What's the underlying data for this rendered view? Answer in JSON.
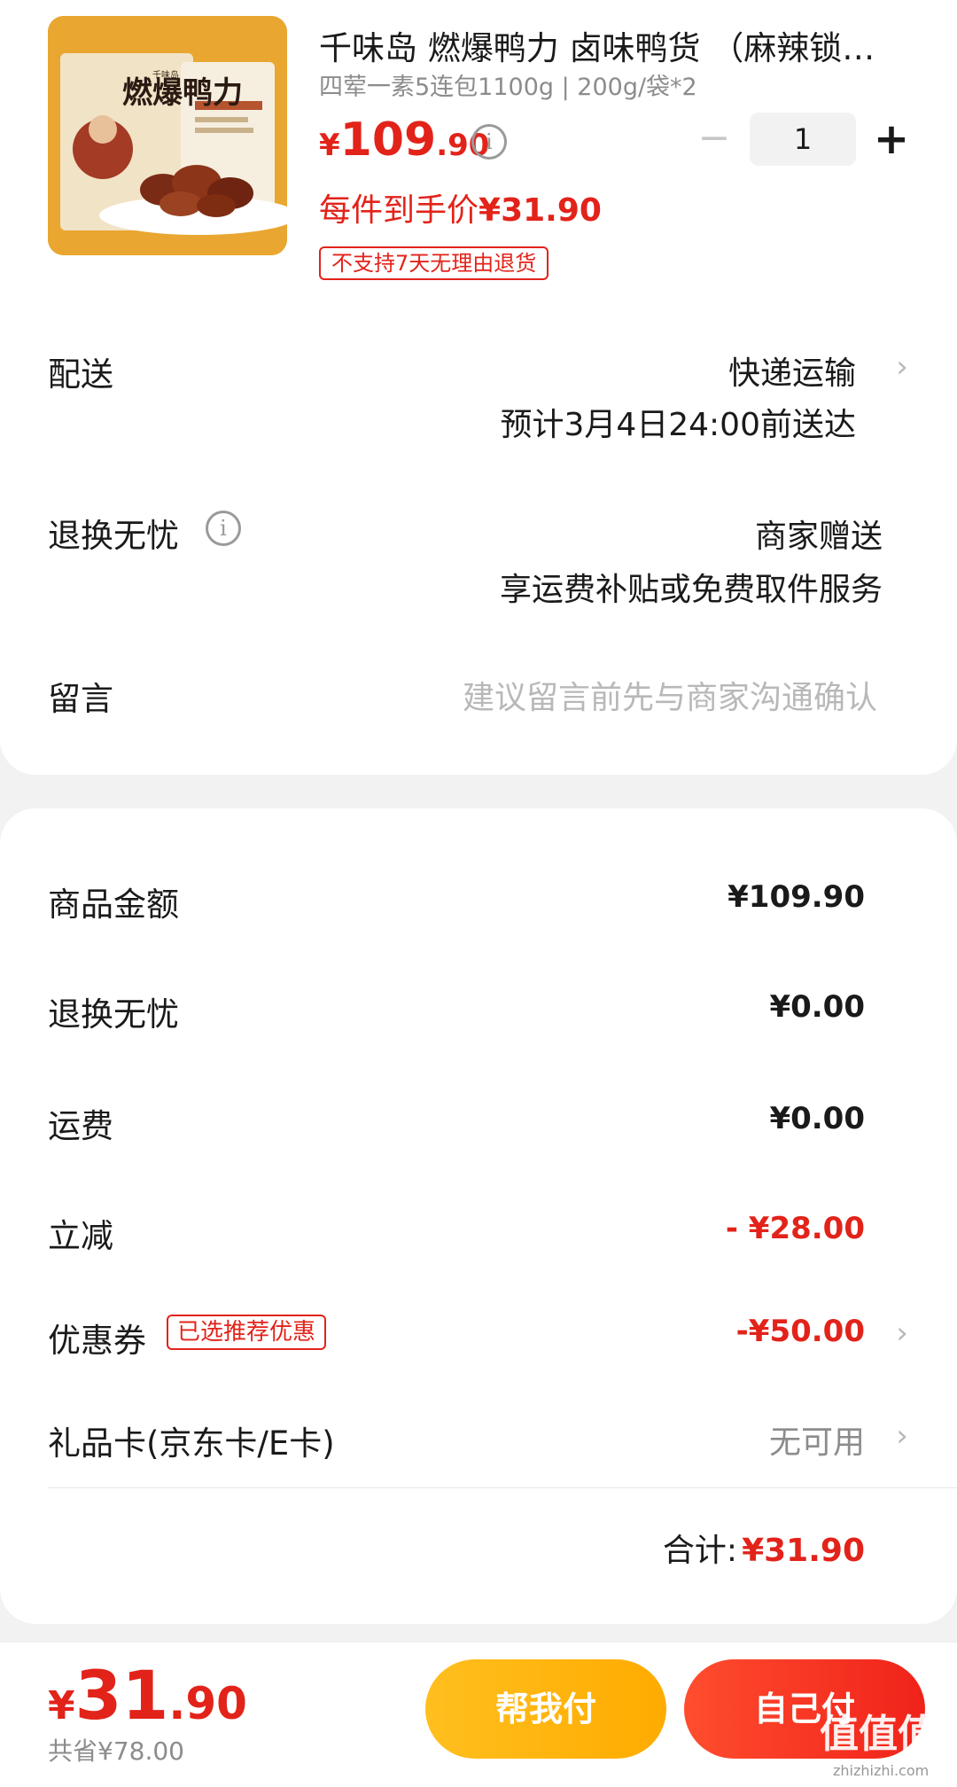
{
  "product": {
    "title": "千味岛 燃爆鸭力 卤味鸭货 （麻辣锁…",
    "spec": "四荤一素5连包1100g | 200g/袋*2",
    "price_currency": "¥",
    "price_int": "109",
    "price_dec": ".90",
    "quantity": "1",
    "minus_label": "−",
    "plus_label": "+",
    "unit_price_label": "每件到手价",
    "unit_price_value": "¥31.90",
    "return_badge": "不支持7天无理由退货",
    "image_text": {
      "brand": "燃爆鸭力",
      "corner": "千味岛"
    }
  },
  "delivery": {
    "label": "配送",
    "method": "快递运输",
    "eta": "预计3月4日24:00前送达"
  },
  "worry_free": {
    "label": "退换无忧",
    "value_line1": "商家赠送",
    "value_line2": "享运费补贴或免费取件服务"
  },
  "message": {
    "label": "留言",
    "placeholder": "建议留言前先与商家沟通确认"
  },
  "summary": {
    "rows": [
      {
        "label": "商品金额",
        "value": "¥109.90"
      },
      {
        "label": "退换无忧",
        "value": "¥0.00"
      },
      {
        "label": "运费",
        "value": "¥0.00"
      },
      {
        "label": "立减",
        "value": "- ¥28.00"
      },
      {
        "label": "优惠券",
        "chip": "已选推荐优惠",
        "value": "-¥50.00"
      },
      {
        "label": "礼品卡(京东卡/E卡)",
        "value": "无可用"
      }
    ],
    "total_label": "合计:",
    "total_value": "¥31.90"
  },
  "bottom": {
    "currency": "¥",
    "int": "31",
    "dec": ".90",
    "saved": "共省¥78.00",
    "help_pay": "帮我付",
    "self_pay": "自己付",
    "watermark": "值值值",
    "watermark_url": "zhizhizhi.com"
  },
  "colors": {
    "accent_red": "#e2231a",
    "help_btn": "#ffb300",
    "self_btn": "#f0221a"
  }
}
